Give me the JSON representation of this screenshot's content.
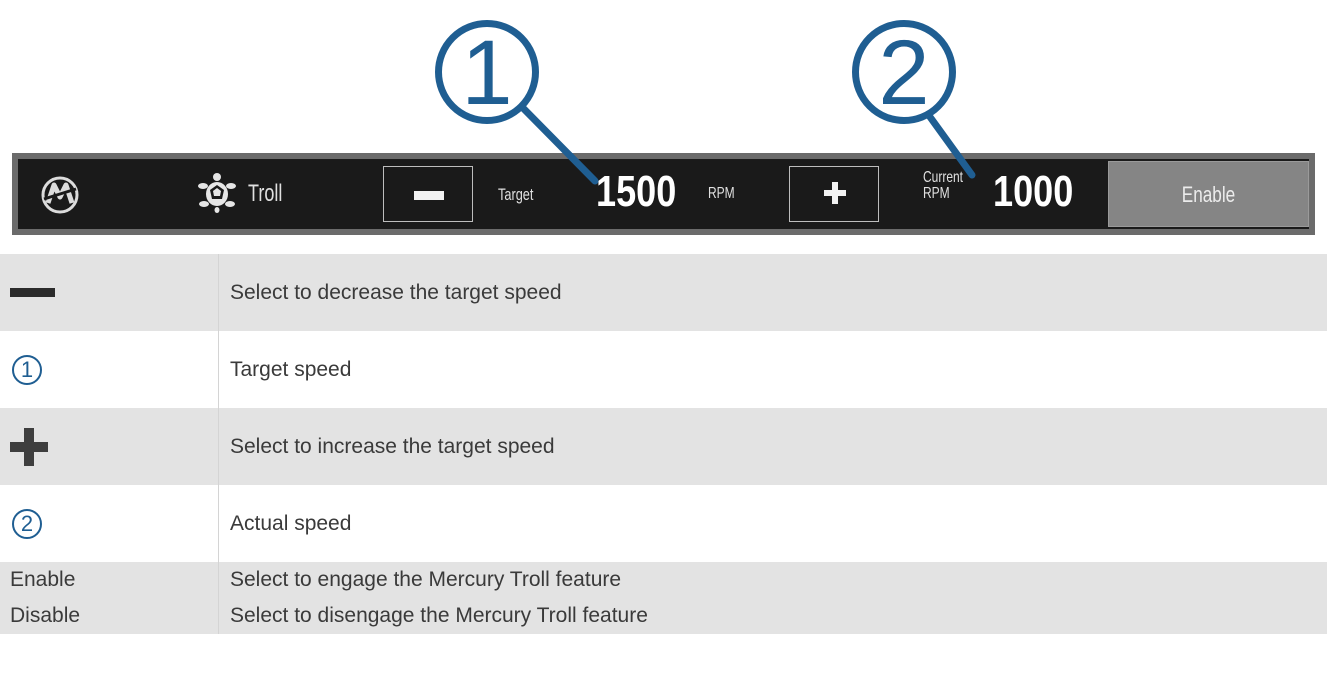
{
  "callouts": [
    "1",
    "2"
  ],
  "troll_bar": {
    "icons": {
      "brand_logo": "mercury-logo-icon",
      "troll_mode": "turtle-icon",
      "decrease": "minus-icon",
      "increase": "plus-icon"
    },
    "troll_label": "Troll",
    "target_label": "Target",
    "target_value": "1500",
    "target_unit": "RPM",
    "current_label_line1": "Current",
    "current_label_line2": "RPM",
    "current_value": "1000",
    "enable_button": "Enable"
  },
  "legend": {
    "rows": [
      {
        "key_type": "icon",
        "key_icon": "minus-icon",
        "description": "Select to decrease the target speed"
      },
      {
        "key_type": "callout",
        "key": "1",
        "description": "Target speed"
      },
      {
        "key_type": "icon",
        "key_icon": "plus-icon",
        "description": "Select to increase the target speed"
      },
      {
        "key_type": "callout",
        "key": "2",
        "description": "Actual speed"
      },
      {
        "key_type": "text",
        "key": "Enable",
        "description": "Select to engage the Mercury Troll feature"
      },
      {
        "key_type": "text",
        "key": "Disable",
        "description": "Select to disengage the Mercury Troll feature"
      }
    ]
  },
  "colors": {
    "callout_blue": "#1f5e92",
    "bar_background": "#1a1a1a",
    "bar_frame": "#6b6b6b",
    "enable_button": "#858585",
    "row_shade": "#e3e3e3"
  }
}
